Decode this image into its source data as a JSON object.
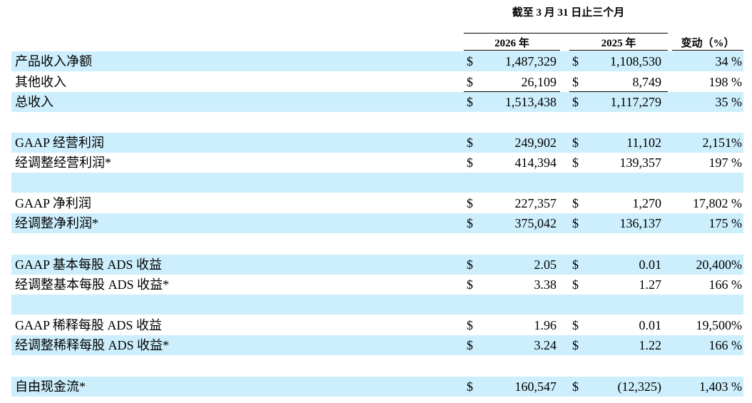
{
  "period_header": "截至 3 月 31 日止三个月",
  "columns": {
    "y2026": "2026 年",
    "y2025": "2025 年",
    "change": "变动（%）"
  },
  "currency_symbol": "$",
  "row_color": "#cdeefc",
  "rows": [
    {
      "label": "产品收入净额",
      "v2026": "1,487,329",
      "v2025": "1,108,530",
      "change": "34 %"
    },
    {
      "label": "其他收入",
      "v2026": "26,109",
      "v2025": "8,749",
      "change": "198 %"
    },
    {
      "label": "总收入",
      "v2026": "1,513,438",
      "v2025": "1,117,279",
      "change": "35 %"
    },
    {
      "label": "",
      "v2026": "",
      "v2025": "",
      "change": ""
    },
    {
      "label": "GAAP 经营利润",
      "v2026": "249,902",
      "v2025": "11,102",
      "change": "2,151%"
    },
    {
      "label": "经调整经营利润*",
      "v2026": "414,394",
      "v2025": "139,357",
      "change": "197 %"
    },
    {
      "label": "",
      "v2026": "",
      "v2025": "",
      "change": ""
    },
    {
      "label": "GAAP 净利润",
      "v2026": "227,357",
      "v2025": "1,270",
      "change": "17,802 %"
    },
    {
      "label": "经调整净利润*",
      "v2026": "375,042",
      "v2025": "136,137",
      "change": "175 %"
    },
    {
      "label": "",
      "v2026": "",
      "v2025": "",
      "change": ""
    },
    {
      "label": "GAAP 基本每股 ADS 收益",
      "v2026": "2.05",
      "v2025": "0.01",
      "change": "20,400%"
    },
    {
      "label": "经调整基本每股 ADS 收益*",
      "v2026": "3.38",
      "v2025": "1.27",
      "change": "166 %"
    },
    {
      "label": "",
      "v2026": "",
      "v2025": "",
      "change": ""
    },
    {
      "label": "GAAP 稀释每股 ADS 收益",
      "v2026": "1.96",
      "v2025": "0.01",
      "change": "19,500%"
    },
    {
      "label": "经调整稀释每股 ADS 收益*",
      "v2026": "3.24",
      "v2025": "1.22",
      "change": "166 %"
    },
    {
      "label": "",
      "v2026": "",
      "v2025": "",
      "change": ""
    },
    {
      "label": "自由现金流*",
      "v2026": "160,547",
      "v2025": "(12,325)",
      "change": "1,403 %"
    }
  ]
}
